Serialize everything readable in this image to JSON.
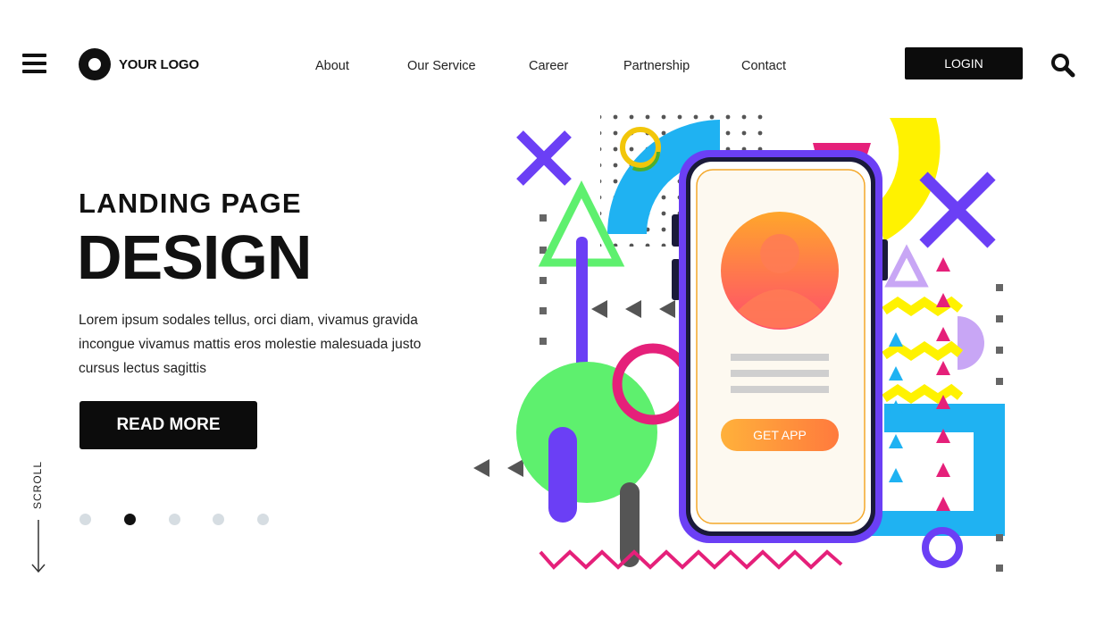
{
  "header": {
    "logo_text": "YOUR LOGO",
    "nav": [
      "About",
      "Our Service",
      "Career",
      "Partnership",
      "Contact"
    ],
    "login_label": "LOGIN"
  },
  "hero": {
    "subtitle": "LANDING PAGE",
    "title": "DESIGN",
    "description": "Lorem ipsum sodales tellus, orci diam, vivamus gravida incongue vivamus mattis eros molestie malesuada justo cursus lectus sagittis",
    "cta_label": "READ MORE"
  },
  "scroll": {
    "label": "SCROLL",
    "active_slide": 2,
    "slide_count": 5
  },
  "phone": {
    "button_label": "GET APP"
  },
  "colors": {
    "primary": "#0c0c0c",
    "purple": "#6b3ff5",
    "green": "#5ef06e",
    "blue": "#1fb2f2",
    "magenta": "#e5207a",
    "yellow": "#fff200",
    "orange": "#ff8a3c"
  },
  "icons": [
    "menu-icon",
    "logo-mark-icon",
    "search-icon",
    "user-icon",
    "arrow-down-icon"
  ]
}
